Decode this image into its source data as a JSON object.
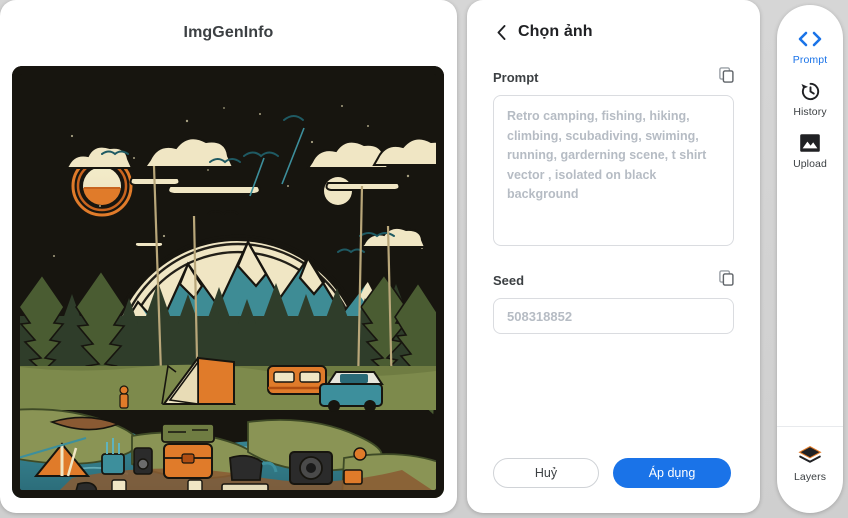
{
  "left": {
    "title": "ImgGenInfo",
    "artwork": {
      "name": "retro-camping-illustration",
      "description": "Retro camping scene t-shirt vector isolated on black background: night sky with ringed orange sun, cream moon, clouds and birds; snow-capped teal mountain range; dense pine forest; cream canvas tent; orange camper van; teal pickup truck; teal river; camp gear in foreground including small tent, backpacks, camera, cookware and crates",
      "palette": {
        "background": "#17150f",
        "cream": "#f0e6c4",
        "teal": "#3e8c95",
        "deep_teal": "#1f5a63",
        "orange": "#e07b2a",
        "moss_green": "#8a9455",
        "dark_green": "#2f3d2a",
        "brown": "#8a5a33"
      }
    }
  },
  "center": {
    "header": {
      "back_icon": "chevron-left-icon",
      "title": "Chọn ảnh"
    },
    "prompt": {
      "label": "Prompt",
      "copy_icon": "copy-icon",
      "value": "Retro camping, fishing, hiking, climbing, scubadiving, swiming, running, garderning scene, t shirt vector , isolated on black background",
      "placeholder": "Retro camping, fishing, hiking, climbing, scubadiving, swiming, running, garderning scene, t shirt vector , isolated on black background"
    },
    "seed": {
      "label": "Seed",
      "copy_icon": "copy-icon",
      "value": "508318852",
      "placeholder": "508318852"
    },
    "buttons": {
      "cancel": "Huỷ",
      "apply": "Áp dụng"
    }
  },
  "rail": {
    "items": [
      {
        "label": "Prompt",
        "icon": "code-brackets-icon",
        "active": true
      },
      {
        "label": "History",
        "icon": "history-clock-icon",
        "active": false
      },
      {
        "label": "Upload",
        "icon": "image-upload-icon",
        "active": false
      }
    ],
    "bottom": {
      "label": "Layers",
      "icon": "layers-icon",
      "active": false
    }
  },
  "colors": {
    "accent_blue": "#1a73e8",
    "page_background": "#d3d3d3",
    "panel_background": "#ffffff",
    "border": "#dadce0",
    "placeholder_text": "#b6bcc4"
  }
}
